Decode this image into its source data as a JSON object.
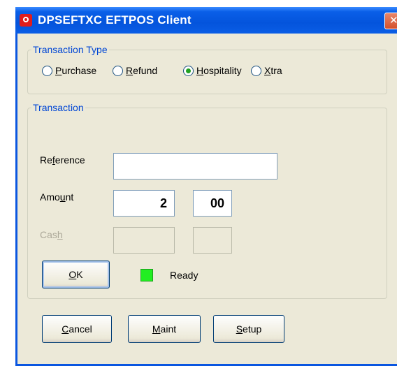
{
  "window": {
    "title": "DPSEFTXC EFTPOS Client",
    "close_glyph": "✕"
  },
  "transaction_type": {
    "legend": "Transaction Type",
    "options": [
      {
        "mn": "P",
        "rest": "urchase",
        "checked": false
      },
      {
        "mn": "R",
        "rest": "efund",
        "checked": false
      },
      {
        "mn": "H",
        "rest": "ospitality",
        "checked": true
      },
      {
        "mn": "X",
        "rest": "tra",
        "checked": false
      }
    ]
  },
  "transaction": {
    "legend": "Transaction",
    "reference": {
      "pre": "Re",
      "mn": "f",
      "post": "erence",
      "value": ""
    },
    "amount": {
      "pre": "Amo",
      "mn": "u",
      "post": "nt",
      "dollars": "2",
      "cents": "00"
    },
    "cash": {
      "pre": "Cas",
      "mn": "h",
      "post": "",
      "dollars": "",
      "cents": ""
    },
    "ok_button": {
      "mn": "O",
      "rest": "K"
    },
    "status_text": "Ready",
    "status_color": "#22ee22"
  },
  "footer": {
    "cancel": {
      "mn": "C",
      "rest": "ancel"
    },
    "maint": {
      "mn": "M",
      "rest": "aint"
    },
    "setup": {
      "mn": "S",
      "rest": "etup"
    }
  },
  "colors": {
    "titlebar": "#0454dc",
    "client_bg": "#ece9d8",
    "legend_text": "#0046d5"
  }
}
